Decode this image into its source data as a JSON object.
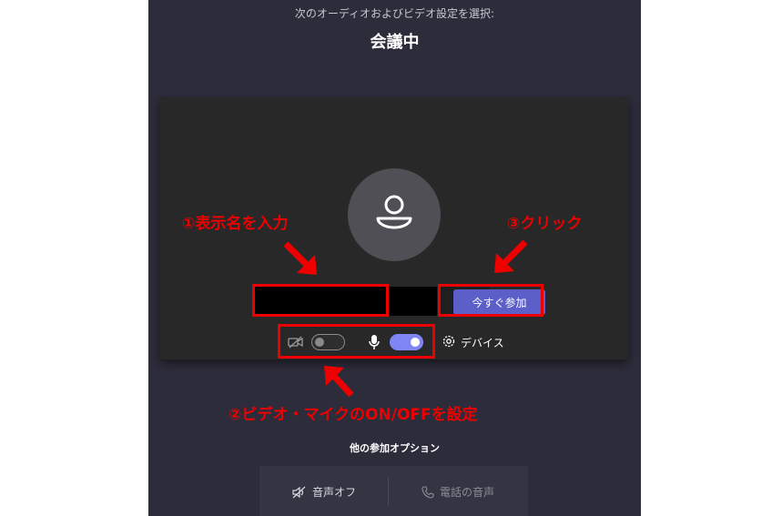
{
  "header": {
    "subtitle": "次のオーディオおよびビデオ設定を選択:",
    "title": "会議中"
  },
  "preview": {
    "name_input_value": "",
    "join_button_label": "今すぐ参加",
    "video_enabled": false,
    "mic_enabled": true,
    "devices_label": "デバイス"
  },
  "annotations": {
    "step1": "①表示名を入力",
    "step2": "②ビデオ・マイクのON/OFFを設定",
    "step3": "③クリック"
  },
  "other_options": {
    "label": "他の参加オプション",
    "audio_off": "音声オフ",
    "phone_audio": "電話の音声"
  },
  "colors": {
    "accent": "#5b5fc7",
    "toggle_on": "#7f85f5",
    "annotation_red": "#ee0000",
    "background": "#2d2c3b"
  }
}
